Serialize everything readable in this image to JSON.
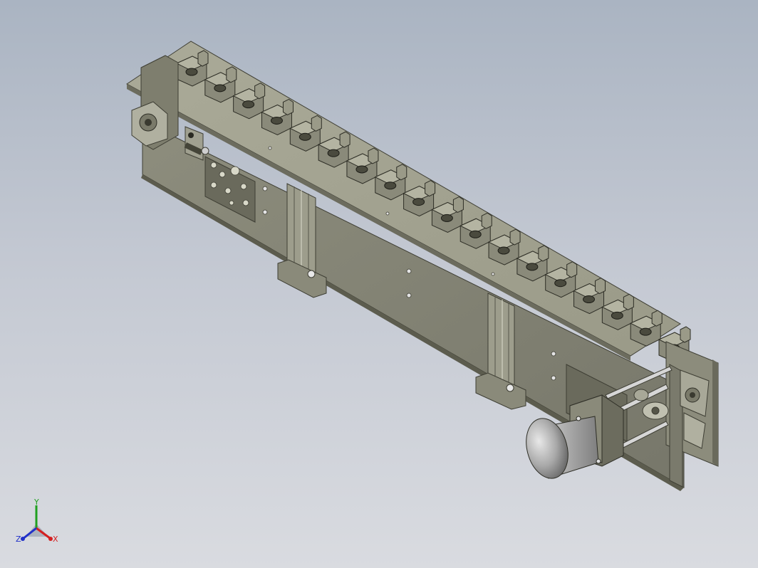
{
  "view": {
    "background_top": "#aab4c2",
    "background_bottom": "#d9dbe0",
    "metal_color": "#8a8a78",
    "metal_dark": "#5e5e50",
    "metal_light": "#b9b9a9"
  },
  "model": {
    "fixture_count": 18,
    "motor_icon": "gear-motor-icon"
  },
  "triad": {
    "x_label": "X",
    "y_label": "Y",
    "z_label": "Z",
    "x_color": "#d42020",
    "y_color": "#20a020",
    "z_color": "#2030c8"
  }
}
